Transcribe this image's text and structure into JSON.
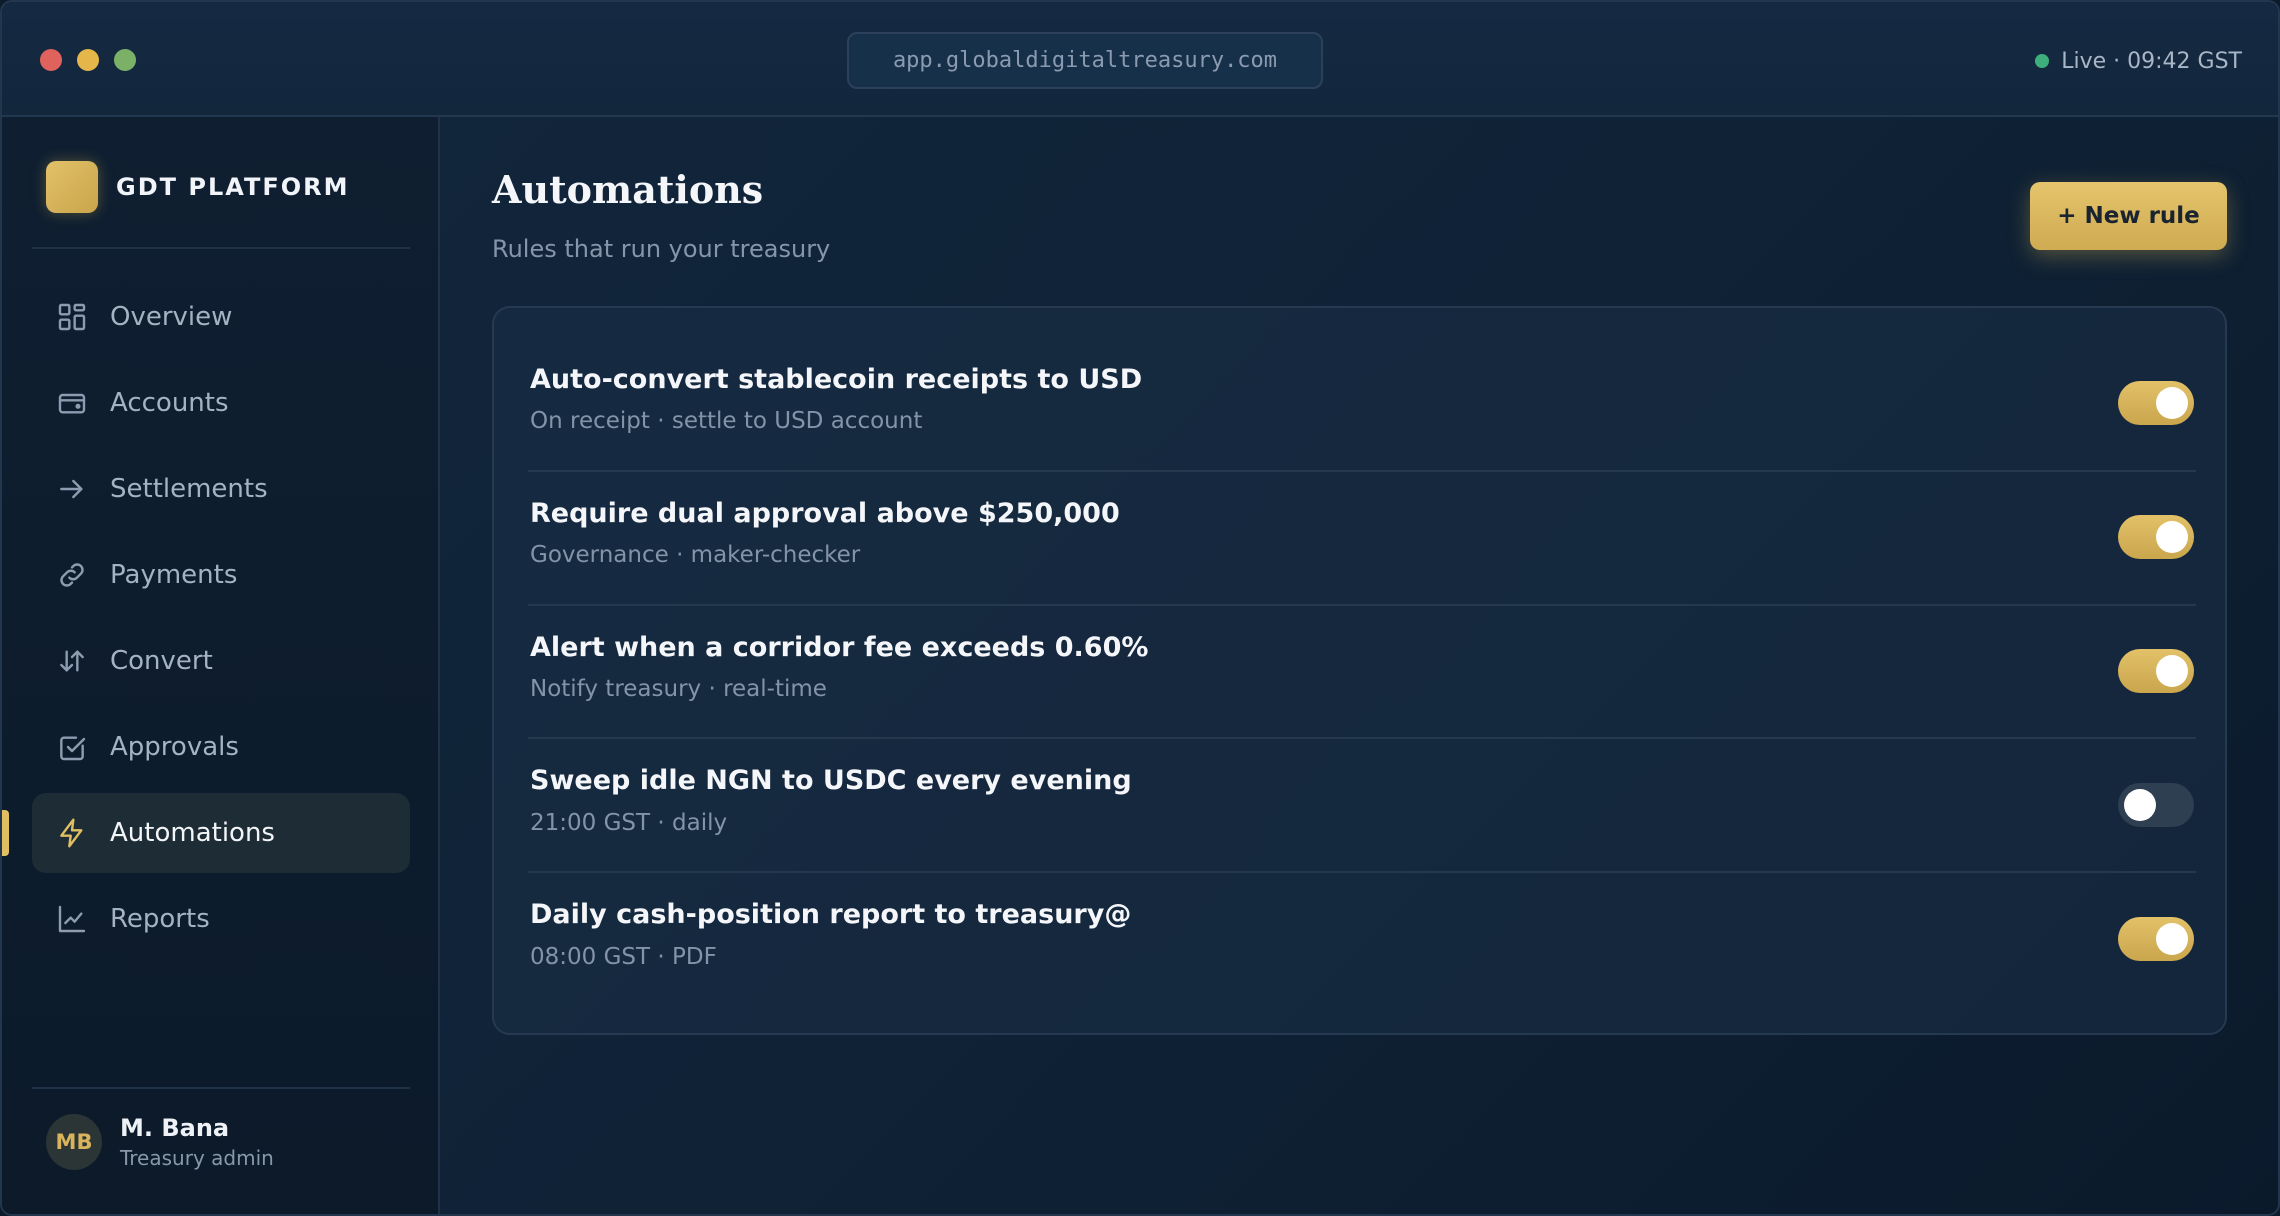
{
  "window": {
    "url": "app.globaldigitaltreasury.com",
    "status": "Live · 09:42 GST",
    "status_color": "#3fae7d"
  },
  "brand": {
    "name": "GDT PLATFORM",
    "accent": "#e0be62"
  },
  "sidebar": {
    "items": [
      {
        "label": "Overview",
        "icon": "grid-icon",
        "active": false
      },
      {
        "label": "Accounts",
        "icon": "wallet-icon",
        "active": false
      },
      {
        "label": "Settlements",
        "icon": "arrow-right-icon",
        "active": false
      },
      {
        "label": "Payments",
        "icon": "link-icon",
        "active": false
      },
      {
        "label": "Convert",
        "icon": "swap-vertical-icon",
        "active": false
      },
      {
        "label": "Approvals",
        "icon": "checkbox-icon",
        "active": false
      },
      {
        "label": "Automations",
        "icon": "lightning-icon",
        "active": true
      },
      {
        "label": "Reports",
        "icon": "line-chart-icon",
        "active": false
      }
    ]
  },
  "user": {
    "initials": "MB",
    "name": "M. Bana",
    "role": "Treasury admin"
  },
  "main": {
    "title": "Automations",
    "subtitle": "Rules that run your treasury",
    "new_rule_label": "+ New rule",
    "rules": [
      {
        "title": "Auto-convert stablecoin receipts to USD",
        "subtitle": "On receipt · settle to USD account",
        "enabled": true
      },
      {
        "title": "Require dual approval above $250,000",
        "subtitle": "Governance · maker-checker",
        "enabled": true
      },
      {
        "title": "Alert when a corridor fee exceeds 0.60%",
        "subtitle": "Notify treasury · real-time",
        "enabled": true
      },
      {
        "title": "Sweep idle NGN to USDC every evening",
        "subtitle": "21:00 GST · daily",
        "enabled": false
      },
      {
        "title": "Daily cash-position report to treasury@",
        "subtitle": "08:00 GST · PDF",
        "enabled": true
      }
    ]
  }
}
